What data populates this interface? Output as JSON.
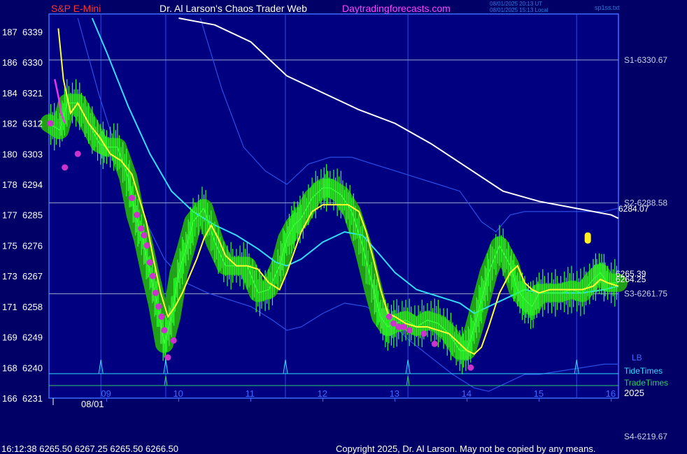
{
  "header": {
    "left_title": "S&P E-Mini",
    "center_title": "Dr. Al Larson's Chaos Trader Web",
    "site": "Daytradingforecasts.com",
    "time_line1": "08/01/2025 20:13 UT",
    "time_line2": "08/01/2025 15:13 Local",
    "file_label": "sp1ss.txt"
  },
  "footer": {
    "quote": "16:12:38  6265.50 6267.25 6265.50 6266.50",
    "copyright": "Copyright 2025, Dr. Al Larson. May not be copied by any means."
  },
  "colors": {
    "background": "#000066",
    "plot_area": "#000080",
    "frame": "#3d6bff",
    "price_bars": "#33ff33",
    "glow_band": "#22aa11",
    "flux_line": "#ffff33",
    "cyan_line": "#33ddff",
    "envelope": "#2a4fe6",
    "slow_line": "#ffffff",
    "magenta": "#cc33cc",
    "tide": "#33ddff",
    "trade": "#33cc66"
  },
  "chart_data": {
    "type": "line",
    "left_axis": [
      {
        "count": "187",
        "price": "6339"
      },
      {
        "count": "186",
        "price": "6330"
      },
      {
        "count": "184",
        "price": "6321"
      },
      {
        "count": "182",
        "price": "6312"
      },
      {
        "count": "180",
        "price": "6303"
      },
      {
        "count": "178",
        "price": "6294"
      },
      {
        "count": "177",
        "price": "6285"
      },
      {
        "count": "175",
        "price": "6276"
      },
      {
        "count": "173",
        "price": "6267"
      },
      {
        "count": "171",
        "price": "6258"
      },
      {
        "count": "169",
        "price": "6249"
      },
      {
        "count": "168",
        "price": "6240"
      },
      {
        "count": "166",
        "price": "6231"
      }
    ],
    "left_axis_values": [
      6339,
      6330,
      6321,
      6312,
      6303,
      6294,
      6285,
      6276,
      6267,
      6258,
      6249,
      6240,
      6231
    ],
    "x_hour_labels": [
      "09",
      "10",
      "11",
      "12",
      "13",
      "14",
      "15",
      "16"
    ],
    "x_hour_values": [
      9,
      10,
      11,
      12,
      13,
      14,
      15,
      16
    ],
    "date_label": "08/01",
    "year_label": "2025",
    "time_range": [
      8.2,
      16.1
    ],
    "ylim": [
      6231,
      6343
    ],
    "levels": [
      {
        "label": "S1-6330.67",
        "value": 6330.67
      },
      {
        "label": "S2-6288.58",
        "value": 6288.58
      },
      {
        "label": "S3-6261.75",
        "value": 6261.75
      },
      {
        "label": "S4-6219.67",
        "value": 6219.67
      }
    ],
    "end_labels": [
      {
        "label": "6284.07",
        "value": 6284.07
      },
      {
        "label": "6265.39",
        "value": 6265.39
      },
      {
        "label": "6264.25",
        "value": 6264.25
      }
    ],
    "lb_label": "LB",
    "tide_label": "TideTimes",
    "trade_label": "TradeTimes",
    "vertical_time_lines": [
      8.92,
      9.82,
      11.48,
      13.18,
      15.52
    ],
    "tide_times": [
      8.92,
      9.82,
      11.48,
      13.18,
      15.52
    ],
    "trade_times": [
      9.82,
      13.18
    ],
    "series": [
      {
        "role": "price",
        "x": [
          8.2,
          8.35,
          8.45,
          8.6,
          8.75,
          8.9,
          9.0,
          9.15,
          9.3,
          9.4,
          9.5,
          9.6,
          9.7,
          9.8,
          9.9,
          10.0,
          10.1,
          10.2,
          10.35,
          10.5,
          10.65,
          10.8,
          10.95,
          11.1,
          11.25,
          11.4,
          11.5,
          11.6,
          11.7,
          11.85,
          12.0,
          12.1,
          12.25,
          12.4,
          12.55,
          12.7,
          12.8,
          12.9,
          13.0,
          13.15,
          13.3,
          13.45,
          13.6,
          13.75,
          13.9,
          14.0,
          14.1,
          14.2,
          14.3,
          14.45,
          14.6,
          14.7,
          14.8,
          14.9,
          15.0,
          15.15,
          15.3,
          15.45,
          15.6,
          15.75,
          15.85,
          15.95,
          16.1
        ],
        "y": [
          6312,
          6310,
          6318,
          6318,
          6312,
          6306,
          6305,
          6305,
          6296,
          6285,
          6278,
          6268,
          6259,
          6247,
          6255,
          6268,
          6275,
          6283,
          6287,
          6277,
          6270,
          6270,
          6270,
          6262,
          6263,
          6270,
          6278,
          6282,
          6284,
          6290,
          6293,
          6293,
          6291,
          6286,
          6276,
          6263,
          6255,
          6252,
          6253,
          6254,
          6252,
          6254,
          6253,
          6250,
          6245,
          6245,
          6252,
          6260,
          6268,
          6276,
          6270,
          6263,
          6260,
          6258,
          6262,
          6262,
          6262,
          6263,
          6262,
          6266,
          6268,
          6265,
          6265
        ]
      },
      {
        "role": "flux",
        "x": [
          8.33,
          8.4,
          8.5,
          8.6,
          8.75,
          8.9,
          9.05,
          9.2,
          9.35,
          9.45,
          9.55,
          9.65,
          9.75,
          9.85,
          9.95,
          10.05,
          10.15,
          10.25,
          10.35,
          10.45,
          10.55,
          10.65,
          10.8,
          10.95,
          11.1,
          11.25,
          11.4,
          11.5,
          11.6,
          11.7,
          11.85,
          12.0,
          12.1,
          12.2,
          12.35,
          12.5,
          12.6,
          12.7,
          12.8,
          12.9,
          13.0,
          13.15,
          13.3,
          13.45,
          13.6,
          13.75,
          13.9,
          14.0,
          14.1,
          14.2,
          14.3,
          14.45,
          14.6,
          14.7,
          14.8,
          14.9,
          15.0,
          15.15,
          15.3,
          15.45,
          15.6,
          15.75,
          15.85,
          15.95,
          16.1
        ],
        "y": [
          6340,
          6325,
          6315,
          6318,
          6312,
          6308,
          6303,
          6301,
          6297,
          6290,
          6283,
          6272,
          6262,
          6255,
          6258,
          6262,
          6267,
          6272,
          6278,
          6282,
          6278,
          6273,
          6270,
          6270,
          6269,
          6265,
          6263,
          6268,
          6274,
          6280,
          6286,
          6288,
          6288,
          6288,
          6288,
          6286,
          6280,
          6272,
          6263,
          6256,
          6255,
          6253,
          6252,
          6252,
          6251,
          6250,
          6247,
          6245,
          6244,
          6246,
          6252,
          6262,
          6268,
          6270,
          6265,
          6263,
          6262,
          6263,
          6263,
          6263,
          6263,
          6264,
          6266,
          6265,
          6264
        ]
      },
      {
        "role": "cyan",
        "x": [
          8.8,
          9.0,
          9.3,
          9.6,
          9.9,
          10.2,
          10.5,
          10.8,
          11.1,
          11.35,
          11.5,
          11.7,
          12.0,
          12.3,
          12.55,
          12.8,
          13.0,
          13.3,
          13.6,
          13.9,
          14.1,
          14.3,
          14.6,
          14.8,
          15.0,
          15.3,
          15.6,
          15.9,
          16.1
        ],
        "y": [
          6343,
          6333,
          6317,
          6303,
          6292,
          6286,
          6282,
          6279,
          6275,
          6271,
          6270,
          6272,
          6277,
          6280,
          6279,
          6273,
          6268,
          6263,
          6261,
          6259,
          6256,
          6258,
          6261,
          6263,
          6262,
          6262,
          6262,
          6263,
          6264
        ]
      },
      {
        "role": "envelope_upper",
        "x": [
          10.3,
          10.6,
          10.9,
          11.2,
          11.5,
          11.8,
          12.1,
          12.4,
          12.7,
          13.0,
          13.3,
          13.6,
          13.9,
          14.2,
          14.4,
          14.6,
          14.8,
          15.0,
          15.3,
          15.6,
          15.9,
          16.1
        ],
        "y": [
          6343,
          6322,
          6305,
          6298,
          6294,
          6300,
          6302,
          6302,
          6300,
          6298,
          6296,
          6294,
          6292,
          6283,
          6280,
          6285,
          6286,
          6286,
          6286,
          6286,
          6286,
          6287
        ]
      },
      {
        "role": "envelope_lower",
        "x": [
          8.6,
          8.9,
          9.2,
          9.5,
          9.8,
          10.1,
          10.4,
          10.7,
          11.0,
          11.3,
          11.5,
          11.7,
          12.0,
          12.3,
          12.6,
          12.9,
          13.2,
          13.5,
          13.8,
          14.1,
          14.3,
          14.5,
          14.8,
          15.0,
          15.3,
          15.6,
          15.9,
          16.1
        ],
        "y": [
          6343,
          6320,
          6300,
          6285,
          6272,
          6265,
          6262,
          6260,
          6258,
          6254,
          6251,
          6252,
          6256,
          6259,
          6258,
          6254,
          6248,
          6243,
          6238,
          6234,
          6233,
          6235,
          6238,
          6238,
          6239,
          6240,
          6241,
          6241
        ]
      },
      {
        "role": "slow_white",
        "x": [
          10.0,
          10.5,
          11.0,
          11.5,
          12.0,
          12.5,
          13.0,
          13.5,
          14.0,
          14.5,
          15.0,
          15.5,
          16.0,
          16.1
        ],
        "y": [
          6343,
          6341,
          6336,
          6326,
          6321,
          6316,
          6312,
          6306,
          6299,
          6292,
          6289,
          6287,
          6285,
          6284
        ]
      },
      {
        "role": "magenta_lead",
        "x": [
          8.28,
          8.33,
          8.37,
          8.42
        ],
        "y": [
          6325,
          6320,
          6315,
          6312
        ]
      }
    ],
    "magenta_points": {
      "x": [
        8.22,
        8.42,
        8.6,
        9.35,
        9.42,
        9.48,
        9.52,
        9.56,
        9.6,
        9.64,
        9.68,
        9.72,
        9.76,
        9.8,
        9.85,
        9.93,
        12.92,
        12.98,
        13.05,
        13.12,
        13.2,
        13.4,
        13.55,
        14.05
      ],
      "y": [
        6312,
        6299,
        6303,
        6290,
        6285,
        6281,
        6279,
        6276,
        6271,
        6267,
        6262,
        6258,
        6255,
        6251,
        6243,
        6248,
        6255,
        6253,
        6252,
        6252,
        6251,
        6250,
        6247,
        6240
      ]
    },
    "yellow_marker": {
      "x": 15.67,
      "y": 6278
    }
  }
}
